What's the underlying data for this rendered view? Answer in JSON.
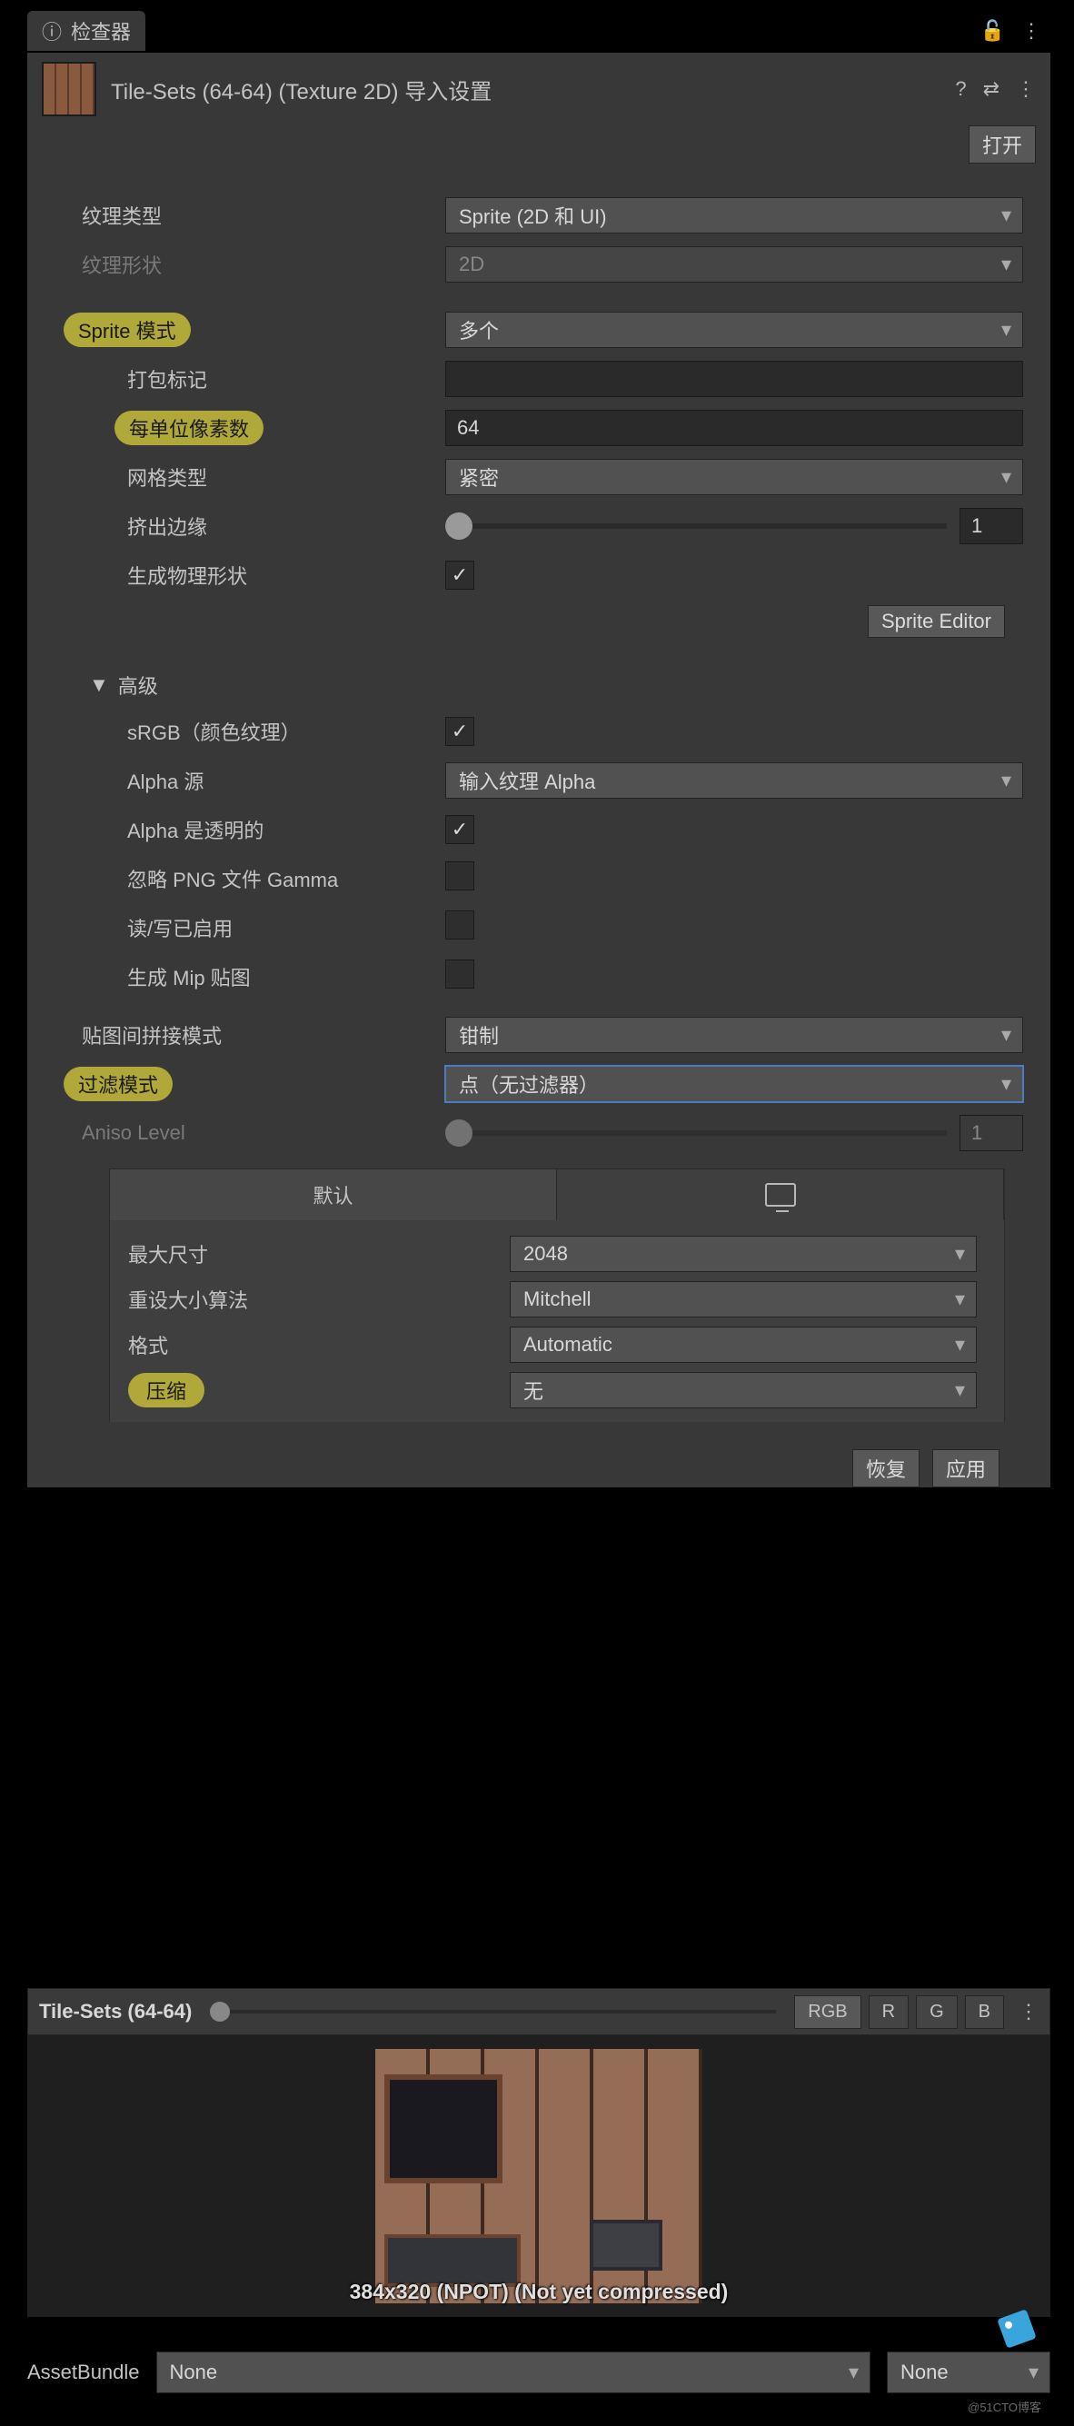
{
  "tab": {
    "title": "检查器",
    "lock_icon": "lock-open-icon",
    "menu_icon": "more-vert-icon"
  },
  "header": {
    "title": "Tile-Sets (64-64) (Texture 2D) 导入设置",
    "help_icon": "help-icon",
    "preset_icon": "preset-icon",
    "more_icon": "more-vert-icon",
    "open_btn": "打开"
  },
  "fields": {
    "texture_type": {
      "label": "纹理类型",
      "value": "Sprite (2D 和 UI)"
    },
    "texture_shape": {
      "label": "纹理形状",
      "value": "2D"
    },
    "sprite_mode": {
      "label": "Sprite 模式",
      "value": "多个"
    },
    "packing_tag": {
      "label": "打包标记",
      "value": ""
    },
    "ppu": {
      "label": "每单位像素数",
      "value": "64"
    },
    "mesh_type": {
      "label": "网格类型",
      "value": "紧密"
    },
    "extrude": {
      "label": "挤出边缘",
      "value": "1"
    },
    "gen_physics": {
      "label": "生成物理形状",
      "checked": true
    },
    "sprite_editor_btn": "Sprite Editor",
    "advanced": "高级",
    "srgb": {
      "label": "sRGB（颜色纹理）",
      "checked": true
    },
    "alpha_src": {
      "label": "Alpha 源",
      "value": "输入纹理 Alpha"
    },
    "alpha_trans": {
      "label": "Alpha 是透明的",
      "checked": true
    },
    "ignore_gamma": {
      "label": "忽略 PNG 文件 Gamma",
      "checked": false
    },
    "rw_enabled": {
      "label": "读/写已启用",
      "checked": false
    },
    "gen_mip": {
      "label": "生成 Mip 贴图",
      "checked": false
    },
    "wrap_mode": {
      "label": "贴图间拼接模式",
      "value": "钳制"
    },
    "filter_mode": {
      "label": "过滤模式",
      "value": "点（无过滤器）"
    },
    "aniso": {
      "label": "Aniso Level",
      "value": "1"
    }
  },
  "platform": {
    "tab_default": "默认",
    "max_size": {
      "label": "最大尺寸",
      "value": "2048"
    },
    "resize_algo": {
      "label": "重设大小算法",
      "value": "Mitchell"
    },
    "format": {
      "label": "格式",
      "value": "Automatic"
    },
    "compression": {
      "label": "压缩",
      "value": "无"
    },
    "revert": "恢复",
    "apply": "应用"
  },
  "preview": {
    "title": "Tile-Sets (64-64)",
    "channels": {
      "rgb": "RGB",
      "r": "R",
      "g": "G",
      "b": "B"
    },
    "caption": "384x320 (NPOT) (Not yet compressed)"
  },
  "asset_bundle": {
    "label": "AssetBundle",
    "bundle": "None",
    "variant": "None"
  },
  "watermark": "@51CTO博客"
}
